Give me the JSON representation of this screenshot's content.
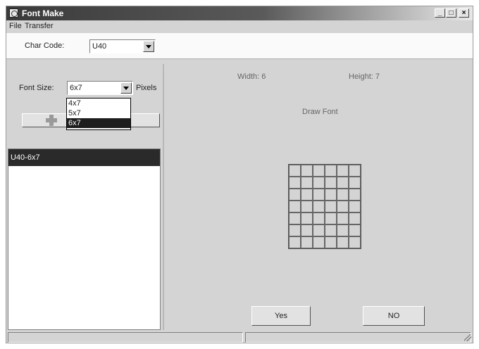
{
  "window": {
    "title": "Font Make",
    "minimize": "_",
    "maximize": "□",
    "close": "×"
  },
  "menu": {
    "file": "File",
    "transfer": "Transfer"
  },
  "toolbar": {
    "char_code_label": "Char Code:",
    "char_code_value": "U40"
  },
  "left": {
    "font_size_label": "Font Size:",
    "font_size_value": "6x7",
    "pixels_label": "Pixels",
    "font_size_options": [
      "4x7",
      "5x7",
      "6x7"
    ],
    "selected_option_index": 2,
    "list_items": [
      "U40-6x7"
    ]
  },
  "right": {
    "width_label": "Width: 6",
    "height_label": "Height: 7",
    "draw_font_label": "Draw Font",
    "grid_cols": 6,
    "grid_rows": 7,
    "yes_label": "Yes",
    "no_label": "NO"
  },
  "icons": {
    "app": "app-icon",
    "add": "plus-icon",
    "dropdown": "chevron-down-icon",
    "resize": "resize-grip-icon"
  }
}
